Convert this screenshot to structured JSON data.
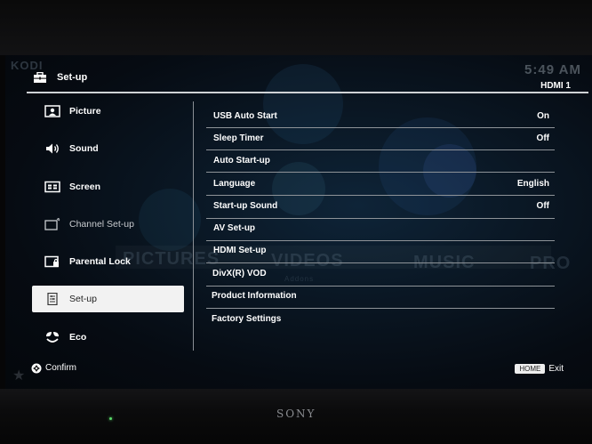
{
  "background_app": {
    "logo": "KODI",
    "time": "5:49 AM",
    "nav": [
      "PICTURES",
      "VIDEOS",
      "MUSIC",
      "PRO"
    ],
    "sub": "Addons"
  },
  "header": {
    "title": "Set-up",
    "title_icon": "toolbox-icon",
    "input": "HDMI 1"
  },
  "sidebar": {
    "items": [
      {
        "label": "Picture",
        "icon": "picture-icon"
      },
      {
        "label": "Sound",
        "icon": "speaker-icon"
      },
      {
        "label": "Screen",
        "icon": "screen-icon"
      },
      {
        "label": "Channel Set-up",
        "icon": "channel-icon"
      },
      {
        "label": "Parental Lock",
        "icon": "lock-icon"
      },
      {
        "label": "Set-up",
        "icon": "setup-icon"
      },
      {
        "label": "Eco",
        "icon": "eco-icon"
      }
    ],
    "selected": "Set-up"
  },
  "settings": {
    "rows": [
      {
        "label": "USB Auto Start",
        "value": "On"
      },
      {
        "label": "Sleep Timer",
        "value": "Off"
      },
      {
        "label": "Auto Start-up",
        "value": ""
      },
      {
        "label": "Language",
        "value": "English"
      },
      {
        "label": "Start-up Sound",
        "value": "Off"
      },
      {
        "label": "AV Set-up",
        "value": ""
      },
      {
        "label": "HDMI Set-up",
        "value": ""
      },
      {
        "label": "DivX(R) VOD",
        "value": ""
      },
      {
        "label": "Product Information",
        "value": ""
      },
      {
        "label": "Factory Settings",
        "value": ""
      }
    ]
  },
  "footer": {
    "confirm_label": "Confirm",
    "home_key": "HOME",
    "exit_label": "Exit"
  },
  "tv": {
    "brand": "SONY"
  },
  "colors": {
    "selected_bg": "#f2f2f2",
    "divider": "#8e9398",
    "text": "#ffffff"
  }
}
